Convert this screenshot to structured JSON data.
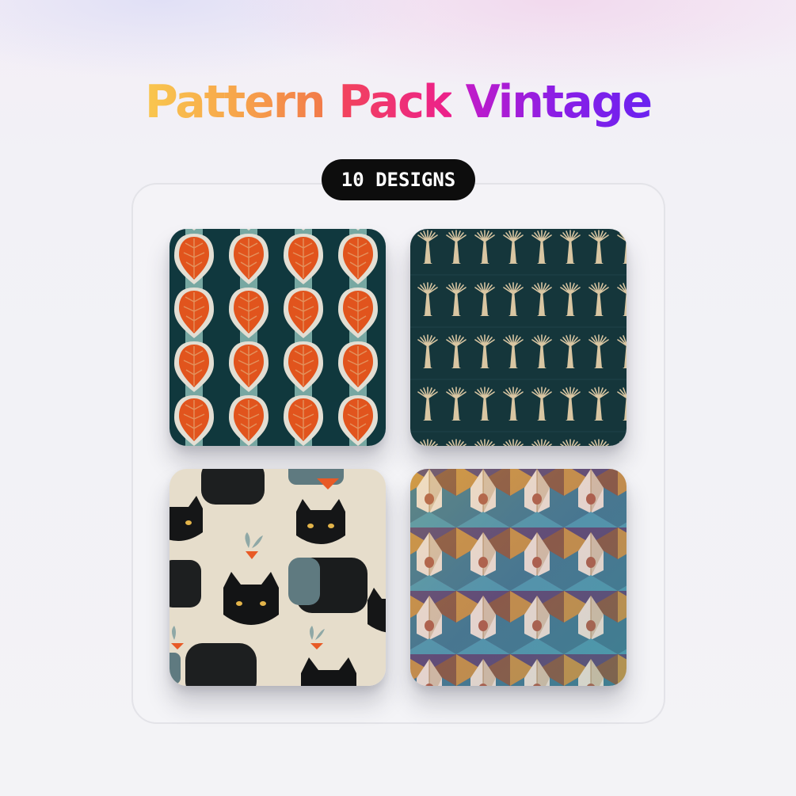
{
  "title": {
    "part1": "Pattern",
    "part2": "Pack",
    "part3": "Vintage"
  },
  "badge": {
    "label": "10 DESIGNS"
  },
  "colors": {
    "title_gradient": [
      "#f9c74f",
      "#f27a4a",
      "#ec1f8c",
      "#8a1ee6",
      "#6b22f0"
    ],
    "badge_background": "#0d0d0d",
    "teal": "#123c42",
    "orange": "#f05a1f",
    "linen": "#e8e0cf"
  },
  "tiles": [
    {
      "icon": "orange-leaf-pattern-icon"
    },
    {
      "icon": "palm-tree-pattern-icon"
    },
    {
      "icon": "black-cat-pattern-icon"
    },
    {
      "icon": "geometric-crystal-pattern-icon"
    }
  ]
}
